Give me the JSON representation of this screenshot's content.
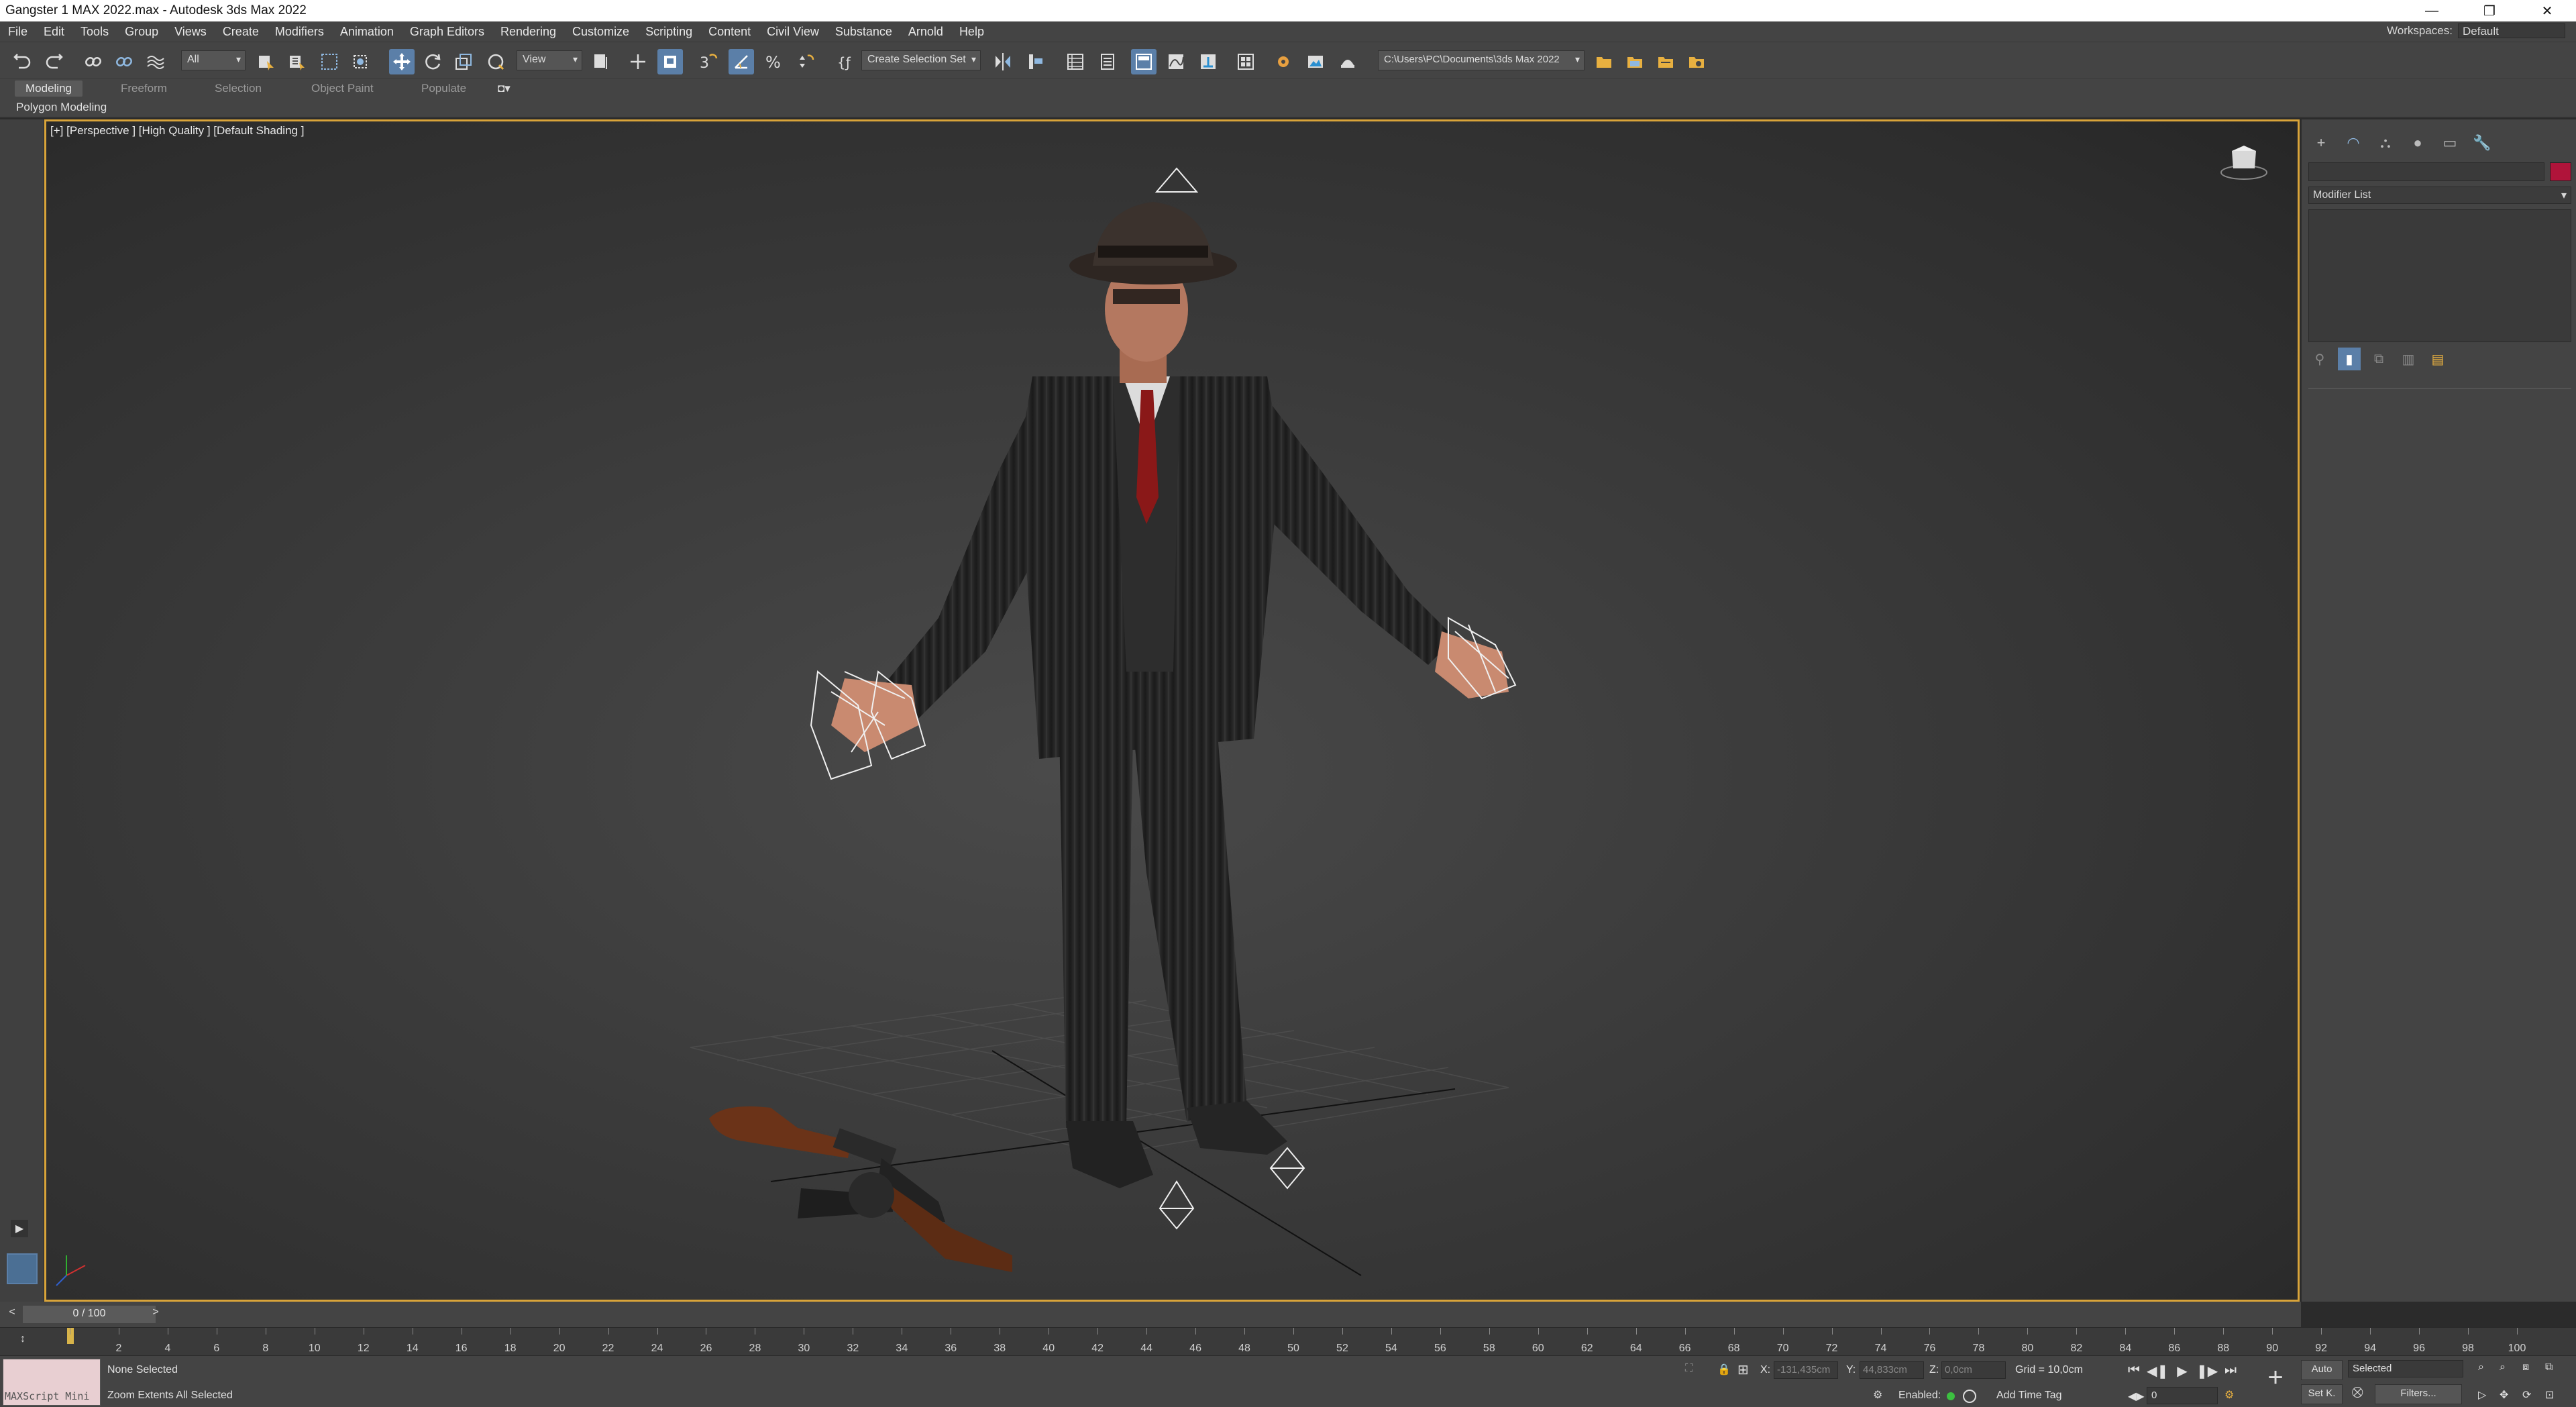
{
  "window": {
    "title": "Gangster 1 MAX 2022.max - Autodesk 3ds Max 2022",
    "controls": [
      "—",
      "❐",
      "✕"
    ]
  },
  "menu": {
    "items": [
      "File",
      "Edit",
      "Tools",
      "Group",
      "Views",
      "Create",
      "Modifiers",
      "Animation",
      "Graph Editors",
      "Rendering",
      "Customize",
      "Scripting",
      "Content",
      "Civil View",
      "Substance",
      "Arnold",
      "Help"
    ],
    "workspaces_label": "Workspaces:",
    "workspaces_value": "Default"
  },
  "toolbar": {
    "selection_filter": "All",
    "reference_coord": "View",
    "snap_3d": "3",
    "selection_set": "Create Selection Set",
    "project_path": "C:\\Users\\PC\\Documents\\3ds Max 2022"
  },
  "ribbon": {
    "tabs": [
      "Modeling",
      "Freeform",
      "Selection",
      "Object Paint",
      "Populate"
    ],
    "active_tab": "Modeling",
    "panel_label": "Polygon Modeling"
  },
  "viewport": {
    "label": "[+] [Perspective ] [High Quality ] [Default Shading ]"
  },
  "command_panel": {
    "modifier_list": "Modifier List",
    "tabs": [
      "+",
      "◠",
      "⛬",
      "●",
      "▭",
      "🔧"
    ],
    "color_swatch": "#b0143a"
  },
  "timeline": {
    "frame_display": "0 / 100",
    "prev": "<",
    "next": ">",
    "ticks": [
      "0",
      "2",
      "4",
      "6",
      "8",
      "10",
      "12",
      "14",
      "16",
      "18",
      "20",
      "22",
      "24",
      "26",
      "28",
      "30",
      "32",
      "34",
      "36",
      "38",
      "40",
      "42",
      "44",
      "46",
      "48",
      "50",
      "52",
      "54",
      "56",
      "58",
      "60",
      "62",
      "64",
      "66",
      "68",
      "70",
      "72",
      "74",
      "76",
      "78",
      "80",
      "82",
      "84",
      "86",
      "88",
      "90",
      "92",
      "94",
      "96",
      "98",
      "100"
    ]
  },
  "status": {
    "maxscript_label": "MAXScript Mini",
    "selection": "None Selected",
    "prompt": "Zoom Extents All Selected",
    "x_label": "X:",
    "x_value": "-131,435cm",
    "y_label": "Y:",
    "y_value": "44,833cm",
    "z_label": "Z:",
    "z_value": "0,0cm",
    "grid": "Grid = 10,0cm",
    "enabled": "Enabled:",
    "add_time_tag": "Add Time Tag",
    "auto": "Auto",
    "set_key": "Set K.",
    "key_mode": "Selected",
    "filters": "Filters...",
    "current_frame": "0"
  }
}
